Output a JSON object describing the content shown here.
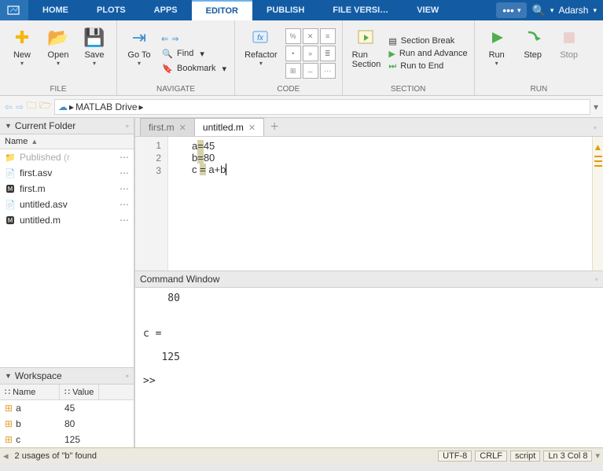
{
  "topbar": {
    "tabs": [
      "HOME",
      "PLOTS",
      "APPS",
      "EDITOR",
      "PUBLISH",
      "FILE VERSI…",
      "VIEW"
    ],
    "active_index": 3,
    "user": "Adarsh"
  },
  "ribbon": {
    "file": {
      "label": "FILE",
      "new": "New",
      "open": "Open",
      "save": "Save"
    },
    "navigate": {
      "label": "NAVIGATE",
      "goto": "Go To",
      "find": "Find",
      "bookmark": "Bookmark"
    },
    "code": {
      "label": "CODE",
      "refactor": "Refactor"
    },
    "section": {
      "label": "SECTION",
      "runsection": "Run\nSection",
      "break": "Section Break",
      "adv": "Run and Advance",
      "toend": "Run to End"
    },
    "run": {
      "label": "RUN",
      "run": "Run",
      "step": "Step",
      "stop": "Stop"
    }
  },
  "pathbar": {
    "root": "MATLAB Drive"
  },
  "currentFolder": {
    "title": "Current Folder",
    "name_col": "Name",
    "items": [
      {
        "icon": "folder",
        "name": "Published",
        "muted": true,
        "suffix": "(r"
      },
      {
        "icon": "file",
        "name": "first.asv"
      },
      {
        "icon": "mfile",
        "name": "first.m"
      },
      {
        "icon": "file",
        "name": "untitled.asv"
      },
      {
        "icon": "mfile",
        "name": "untitled.m"
      }
    ]
  },
  "workspace": {
    "title": "Workspace",
    "cols": {
      "name": "Name",
      "value": "Value"
    },
    "vars": [
      {
        "name": "a",
        "value": "45"
      },
      {
        "name": "b",
        "value": "80"
      },
      {
        "name": "c",
        "value": "125"
      }
    ]
  },
  "editor": {
    "tabs": [
      {
        "name": "first.m"
      },
      {
        "name": "untitled.m"
      }
    ],
    "active_index": 1,
    "lines": [
      {
        "n": "1",
        "pre": "a",
        "hl": "=",
        "post": "45"
      },
      {
        "n": "2",
        "pre": "b",
        "hl": "=",
        "post": "80"
      },
      {
        "n": "3",
        "pre": "c ",
        "hl": "=",
        "post": " a+b",
        "cursor": true
      }
    ]
  },
  "command": {
    "title": "Command Window",
    "body": "    80\n\n\nc =\n\n   125\n\n>> "
  },
  "status": {
    "msg": "2 usages of \"b\" found",
    "enc": "UTF-8",
    "eol": "CRLF",
    "type": "script",
    "pos": "Ln 3  Col 8"
  }
}
